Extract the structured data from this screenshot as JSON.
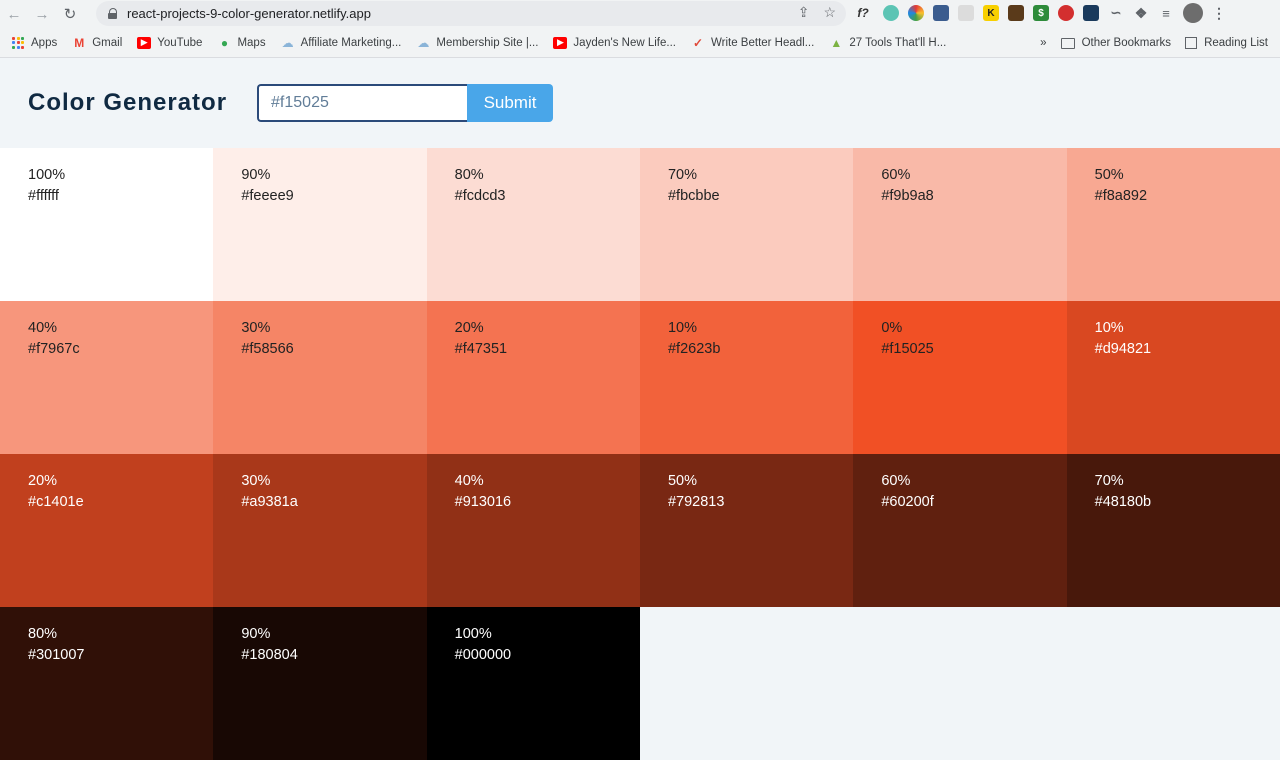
{
  "browser": {
    "url": "react-projects-9-color-generator.netlify.app",
    "back_icon": "arrow-left-icon",
    "forward_icon": "arrow-right-icon",
    "reload_icon": "reload-icon",
    "extension_f_label": "f?",
    "bookmarks": [
      {
        "label": "Apps",
        "icon": "apps-grid-icon"
      },
      {
        "label": "Gmail",
        "icon": "gmail-icon"
      },
      {
        "label": "YouTube",
        "icon": "youtube-icon"
      },
      {
        "label": "Maps",
        "icon": "maps-icon"
      },
      {
        "label": "Affiliate Marketing...",
        "icon": "cloud-icon"
      },
      {
        "label": "Membership Site |...",
        "icon": "cloud-icon"
      },
      {
        "label": "Jayden's New Life...",
        "icon": "youtube-icon"
      },
      {
        "label": "Write Better Headl...",
        "icon": "headline-icon"
      },
      {
        "label": "27 Tools That'll H...",
        "icon": "tools-icon"
      }
    ],
    "more_bookmarks": "»",
    "other_bookmarks": "Other Bookmarks",
    "reading_list": "Reading List"
  },
  "app": {
    "title": "Color Generator",
    "input_value": "#f15025",
    "submit_label": "Submit"
  },
  "colors": [
    {
      "percent": "100%",
      "hex": "#ffffff",
      "dark": false
    },
    {
      "percent": "90%",
      "hex": "#feeee9",
      "dark": false
    },
    {
      "percent": "80%",
      "hex": "#fcdcd3",
      "dark": false
    },
    {
      "percent": "70%",
      "hex": "#fbcbbe",
      "dark": false
    },
    {
      "percent": "60%",
      "hex": "#f9b9a8",
      "dark": false
    },
    {
      "percent": "50%",
      "hex": "#f8a892",
      "dark": false
    },
    {
      "percent": "40%",
      "hex": "#f7967c",
      "dark": false
    },
    {
      "percent": "30%",
      "hex": "#f58566",
      "dark": false
    },
    {
      "percent": "20%",
      "hex": "#f47351",
      "dark": false
    },
    {
      "percent": "10%",
      "hex": "#f2623b",
      "dark": false
    },
    {
      "percent": "0%",
      "hex": "#f15025",
      "dark": false
    },
    {
      "percent": "10%",
      "hex": "#d94821",
      "dark": true
    },
    {
      "percent": "20%",
      "hex": "#c1401e",
      "dark": true
    },
    {
      "percent": "30%",
      "hex": "#a9381a",
      "dark": true
    },
    {
      "percent": "40%",
      "hex": "#913016",
      "dark": true
    },
    {
      "percent": "50%",
      "hex": "#792813",
      "dark": true
    },
    {
      "percent": "60%",
      "hex": "#60200f",
      "dark": true
    },
    {
      "percent": "70%",
      "hex": "#48180b",
      "dark": true
    },
    {
      "percent": "80%",
      "hex": "#301007",
      "dark": true
    },
    {
      "percent": "90%",
      "hex": "#180804",
      "dark": true
    },
    {
      "percent": "100%",
      "hex": "#000000",
      "dark": true
    }
  ]
}
